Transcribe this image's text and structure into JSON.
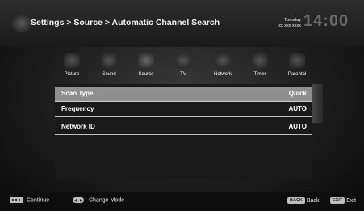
{
  "header": {
    "breadcrumb": "Settings > Source > Automatic Channel Search",
    "day": "Tuesday",
    "date": "xx xxx xxxx",
    "clock": "14:00"
  },
  "tabs": [
    {
      "label": "Picture",
      "icon": "picture-icon"
    },
    {
      "label": "Sound",
      "icon": "sound-icon"
    },
    {
      "label": "Source",
      "icon": "source-icon",
      "active": true
    },
    {
      "label": "TV",
      "icon": "tv-icon"
    },
    {
      "label": "Network",
      "icon": "network-icon"
    },
    {
      "label": "Timer",
      "icon": "timer-icon"
    },
    {
      "label": "Parental",
      "icon": "parental-icon"
    }
  ],
  "settings": [
    {
      "label": "Scan Type",
      "value": "Quick",
      "selected": true
    },
    {
      "label": "Frequency",
      "value": "AUTO"
    },
    {
      "label": "Network ID",
      "value": "AUTO"
    }
  ],
  "footer": {
    "continue_label": "Continue",
    "change_mode_label": "Change Mode",
    "back_key": "BACK",
    "back_label": "Back",
    "exit_key": "EXIT",
    "exit_label": "Exit"
  },
  "colors": {
    "selected_row": "#8f8f8f",
    "key_bg": "#bdbdbd"
  }
}
